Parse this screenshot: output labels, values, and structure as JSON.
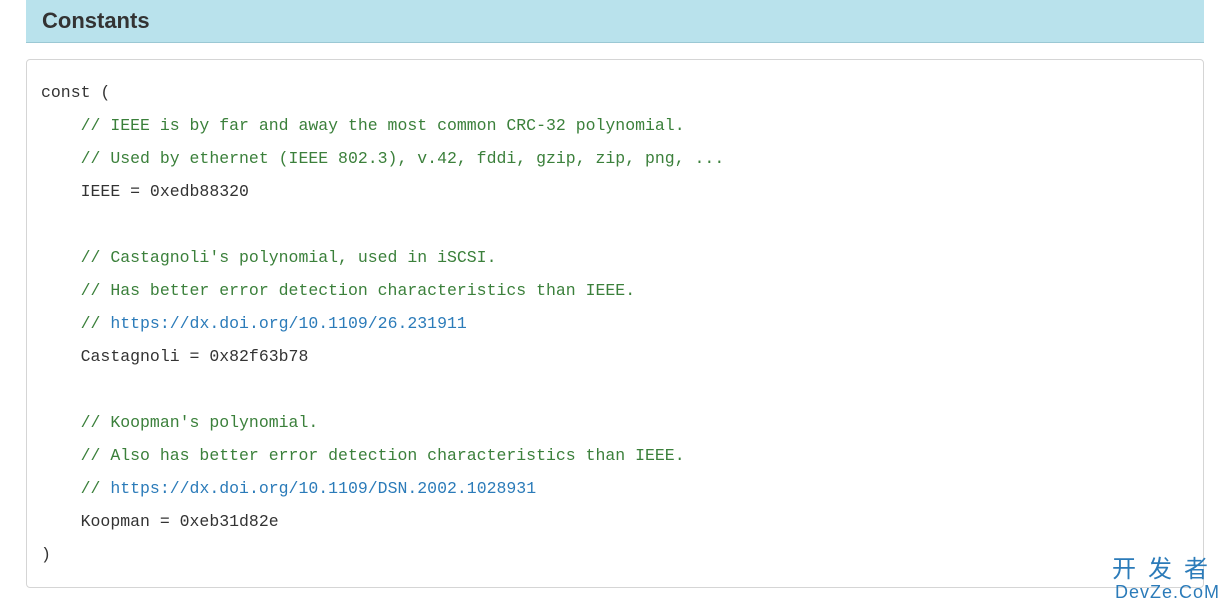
{
  "section": {
    "title": "Constants"
  },
  "code": {
    "const_open": "const (",
    "ieee_comment1": "// IEEE is by far and away the most common CRC-32 polynomial.",
    "ieee_comment2": "// Used by ethernet (IEEE 802.3), v.42, fddi, gzip, zip, png, ...",
    "ieee_def": "IEEE = 0xedb88320",
    "castagnoli_comment1": "// Castagnoli's polynomial, used in iSCSI.",
    "castagnoli_comment2": "// Has better error detection characteristics than IEEE.",
    "castagnoli_link_prefix": "// ",
    "castagnoli_link": "https://dx.doi.org/10.1109/26.231911",
    "castagnoli_def": "Castagnoli = 0x82f63b78",
    "koopman_comment1": "// Koopman's polynomial.",
    "koopman_comment2": "// Also has better error detection characteristics than IEEE.",
    "koopman_link_prefix": "// ",
    "koopman_link": "https://dx.doi.org/10.1109/DSN.2002.1028931",
    "koopman_def": "Koopman = 0xeb31d82e",
    "const_close": ")"
  },
  "watermark": {
    "cn": "开发者",
    "en": "DevZe.CoM"
  }
}
